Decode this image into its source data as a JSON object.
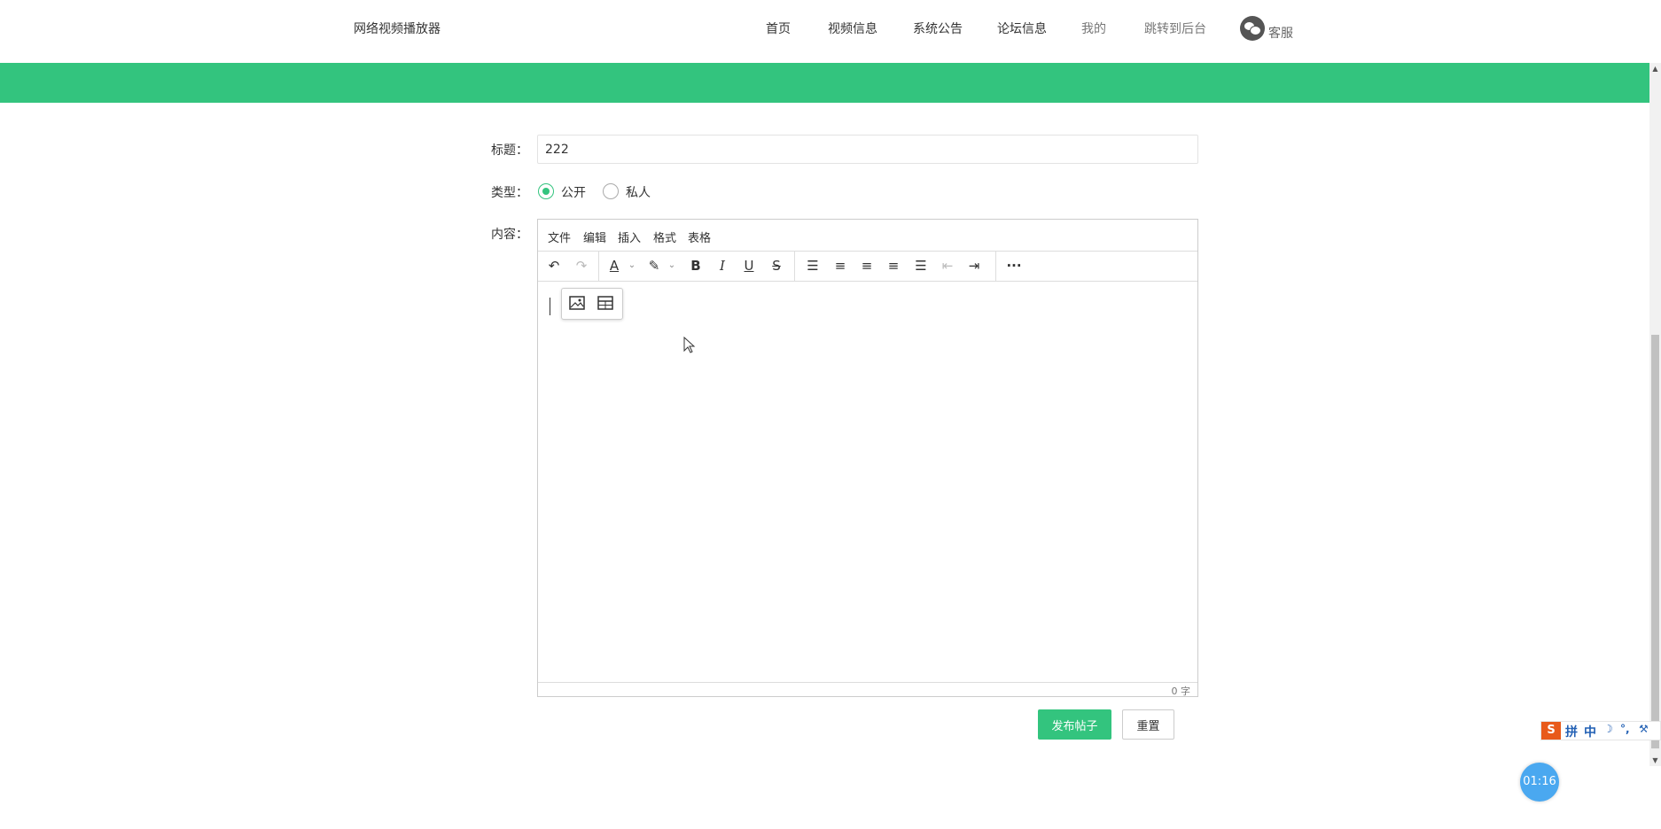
{
  "header": {
    "brand": "网络视频播放器",
    "nav": [
      "首页",
      "视频信息",
      "系统公告",
      "论坛信息",
      "我的",
      "跳转到后台"
    ],
    "service": "客服"
  },
  "form": {
    "title_label": "标题：",
    "title_value": "222",
    "type_label": "类型：",
    "type_options": [
      "公开",
      "私人"
    ],
    "type_selected": "公开",
    "content_label": "内容："
  },
  "editor": {
    "menus": [
      "文件",
      "编辑",
      "插入",
      "格式",
      "表格"
    ],
    "word_count": "0 字",
    "toolbar_icons": [
      "undo-icon",
      "redo-icon",
      "text-color-icon",
      "highlight-color-icon",
      "bold-icon",
      "italic-icon",
      "underline-icon",
      "strikethrough-icon",
      "line-height-icon",
      "align-left-icon",
      "align-center-icon",
      "align-right-icon",
      "align-justify-icon",
      "outdent-icon",
      "indent-icon",
      "more-icon"
    ],
    "quickbar_icons": [
      "image-icon",
      "table-icon"
    ]
  },
  "actions": {
    "publish": "发布帖子",
    "reset": "重置"
  },
  "ime": {
    "logo": "S",
    "mode": "拼",
    "lang": "中"
  },
  "timer": "01:16",
  "colors": {
    "accent": "#33c47e",
    "timer": "#4aa8f0",
    "ime_logo": "#e85a1b"
  }
}
